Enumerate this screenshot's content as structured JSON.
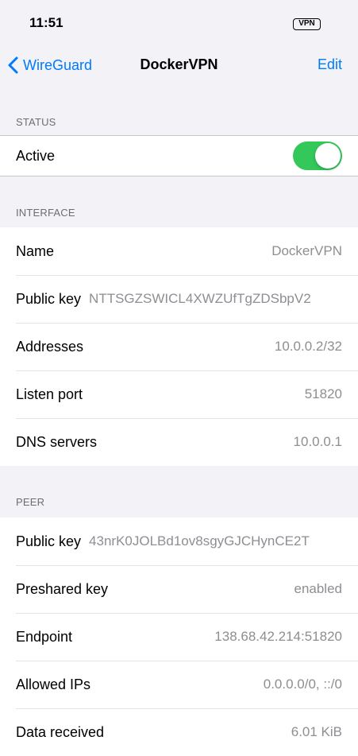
{
  "status_bar": {
    "time": "11:51",
    "vpn_badge": "VPN"
  },
  "nav": {
    "back_label": "WireGuard",
    "title": "DockerVPN",
    "edit_label": "Edit",
    "accent_color": "#007aff"
  },
  "status_section": {
    "header": "STATUS",
    "active_label": "Active",
    "active_on": true,
    "toggle_color": "#34c759"
  },
  "interface_section": {
    "header": "INTERFACE",
    "rows": [
      {
        "label": "Name",
        "value": "DockerVPN"
      },
      {
        "label": "Public key",
        "value": "NTTSGZSWICL4XWZUfTgZDSbpV2"
      },
      {
        "label": "Addresses",
        "value": "10.0.0.2/32"
      },
      {
        "label": "Listen port",
        "value": "51820"
      },
      {
        "label": "DNS servers",
        "value": "10.0.0.1"
      }
    ]
  },
  "peer_section": {
    "header": "PEER",
    "rows": [
      {
        "label": "Public key",
        "value": "43nrK0JOLBd1ov8sgyGJCHynCE2T"
      },
      {
        "label": "Preshared key",
        "value": "enabled"
      },
      {
        "label": "Endpoint",
        "value": "138.68.42.214:51820"
      },
      {
        "label": "Allowed IPs",
        "value": "0.0.0.0/0, ::/0"
      },
      {
        "label": "Data received",
        "value": "6.01 KiB"
      }
    ]
  }
}
